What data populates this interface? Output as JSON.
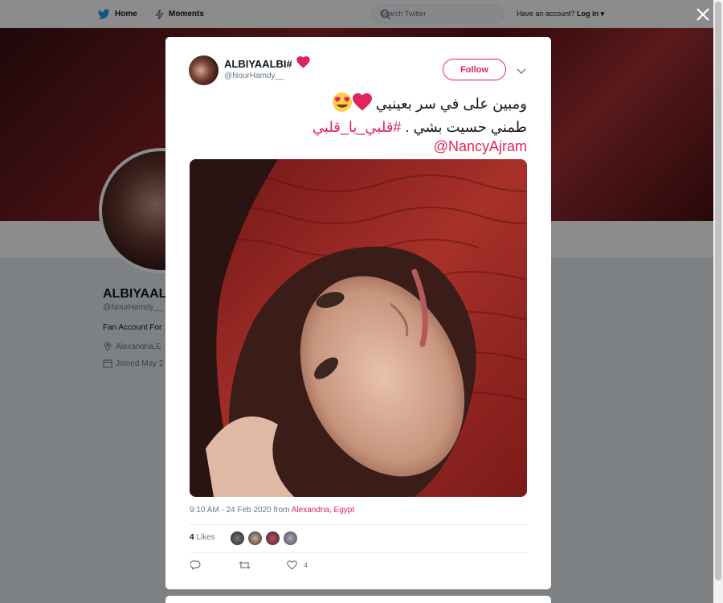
{
  "nav": {
    "home_label": "Home",
    "moments_label": "Moments",
    "search_placeholder": "Search Twitter",
    "have_account": "Have an account?",
    "login_label": "Log in ▾"
  },
  "profile": {
    "name": "ALBIYAAL",
    "handle": "@NourHamdy__",
    "bio": "Fan Account For",
    "location": "Alexandria,E",
    "joined": "Joined May 2"
  },
  "tweet": {
    "author_name": "ALBIYAALBI#",
    "author_handle": "@NourHamdy__",
    "follow_label": "Follow",
    "text_line1": "ومبين على في سر بعينيي",
    "text_line2": "طمني حسيت بشي .",
    "hashtag": "#قلبي_يا_قلبي",
    "mention": "@NancyAjram",
    "time": "9:10 AM - 24 Feb 2020 from ",
    "location": "Alexandria, Egypt",
    "likes_count": "4",
    "likes_label": " Likes",
    "like_action_count": "4"
  },
  "colors": {
    "accent": "#e0245e",
    "twitter_blue": "#1da1f2",
    "text": "#14171a",
    "muted": "#657786"
  },
  "icons": [
    "twitter-bird-icon",
    "moments-icon",
    "search-icon",
    "close-icon",
    "heart-icon",
    "heart-eyes-emoji-icon",
    "chevron-down-icon",
    "reply-icon",
    "retweet-icon",
    "like-icon",
    "location-icon",
    "calendar-icon"
  ]
}
